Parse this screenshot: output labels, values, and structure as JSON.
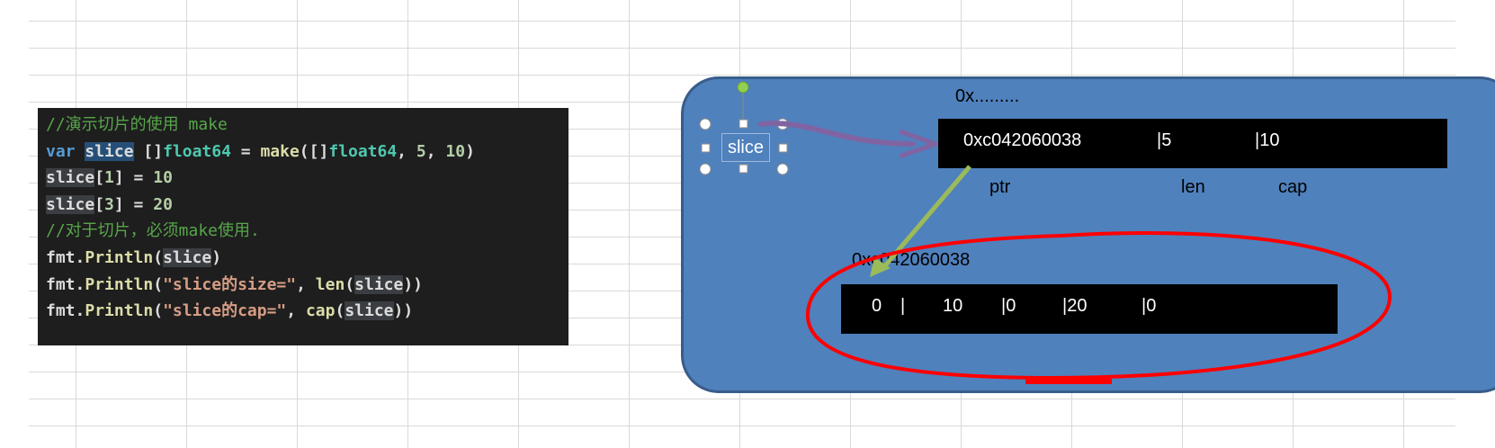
{
  "code": {
    "lines": [
      [
        {
          "t": "//演示切片的使用 make",
          "c": "comment"
        }
      ],
      [
        {
          "t": "var ",
          "c": "kw"
        },
        {
          "t": "slice",
          "c": "plain",
          "sel": true
        },
        {
          "t": " []",
          "c": "plain"
        },
        {
          "t": "float64",
          "c": "type"
        },
        {
          "t": " = ",
          "c": "plain"
        },
        {
          "t": "make",
          "c": "fn"
        },
        {
          "t": "([]",
          "c": "plain"
        },
        {
          "t": "float64",
          "c": "type"
        },
        {
          "t": ", ",
          "c": "plain"
        },
        {
          "t": "5",
          "c": "num"
        },
        {
          "t": ", ",
          "c": "plain"
        },
        {
          "t": "10",
          "c": "num"
        },
        {
          "t": ")",
          "c": "plain"
        }
      ],
      [
        {
          "t": "slice",
          "c": "plain",
          "hl": true
        },
        {
          "t": "[",
          "c": "plain"
        },
        {
          "t": "1",
          "c": "num"
        },
        {
          "t": "] = ",
          "c": "plain"
        },
        {
          "t": "10",
          "c": "num"
        }
      ],
      [
        {
          "t": "slice",
          "c": "plain",
          "hl": true
        },
        {
          "t": "[",
          "c": "plain"
        },
        {
          "t": "3",
          "c": "num"
        },
        {
          "t": "] = ",
          "c": "plain"
        },
        {
          "t": "20",
          "c": "num"
        }
      ],
      [
        {
          "t": "//对于切片，必须make使用.",
          "c": "comment"
        }
      ],
      [
        {
          "t": "fmt.",
          "c": "plain"
        },
        {
          "t": "Println",
          "c": "fn"
        },
        {
          "t": "(",
          "c": "plain"
        },
        {
          "t": "slice",
          "c": "plain",
          "hl": true
        },
        {
          "t": ")",
          "c": "plain"
        }
      ],
      [
        {
          "t": "fmt.",
          "c": "plain"
        },
        {
          "t": "Println",
          "c": "fn"
        },
        {
          "t": "(",
          "c": "plain"
        },
        {
          "t": "\"slice的size=\"",
          "c": "str"
        },
        {
          "t": ", ",
          "c": "plain"
        },
        {
          "t": "len",
          "c": "fn"
        },
        {
          "t": "(",
          "c": "plain"
        },
        {
          "t": "slice",
          "c": "plain",
          "hl": true
        },
        {
          "t": "))",
          "c": "plain"
        }
      ],
      [
        {
          "t": "fmt.",
          "c": "plain"
        },
        {
          "t": "Println",
          "c": "fn"
        },
        {
          "t": "(",
          "c": "plain"
        },
        {
          "t": "\"slice的cap=\"",
          "c": "str"
        },
        {
          "t": ", ",
          "c": "plain"
        },
        {
          "t": "cap",
          "c": "fn"
        },
        {
          "t": "(",
          "c": "plain"
        },
        {
          "t": "slice",
          "c": "plain",
          "hl": true
        },
        {
          "t": "))",
          "c": "plain"
        }
      ]
    ]
  },
  "diagram": {
    "slice_var_label": "slice",
    "header_address_label": "0x.........",
    "header_fields": [
      "0xc042060038",
      "|5",
      "|10"
    ],
    "header_field_names": [
      "ptr",
      "len",
      "cap"
    ],
    "array_address_label": "0xc042060038",
    "array_cells": [
      "0",
      "|",
      "10",
      "|0",
      "|20",
      "|0"
    ]
  },
  "colors": {
    "panel_fill": "#4f81bd",
    "panel_border": "#385d8a",
    "bar_fill": "#000000",
    "connector_arrow": "#8064a2",
    "pointer_arrow": "#9bbb59",
    "highlight_circle": "#ff0000"
  },
  "icons": {
    "rotate_handle": "green-dot",
    "resize_handles": "white-circles-and-squares"
  }
}
